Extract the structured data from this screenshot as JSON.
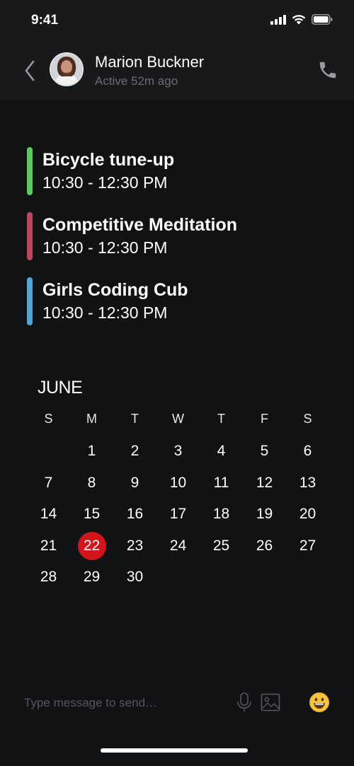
{
  "status_bar": {
    "time": "9:41",
    "icons": [
      "signal-icon",
      "wifi-icon",
      "battery-icon"
    ]
  },
  "header": {
    "back_icon": "chevron-left-icon",
    "contact_name": "Marion Buckner",
    "contact_status": "Active 52m ago",
    "call_icon": "phone-icon"
  },
  "events": [
    {
      "title": "Bicycle tune-up",
      "time": "10:30 - 12:30 PM",
      "color": "#5ccb5f"
    },
    {
      "title": "Competitive Meditation",
      "time": "10:30 - 12:30 PM",
      "color": "#c2455f"
    },
    {
      "title": "Girls Coding Cub",
      "time": "10:30 - 12:30 PM",
      "color": "#4fa8d8"
    }
  ],
  "calendar": {
    "month": "JUNE",
    "weekdays": [
      "S",
      "M",
      "T",
      "W",
      "T",
      "F",
      "S"
    ],
    "leading_blanks": 1,
    "days": [
      "1",
      "2",
      "3",
      "4",
      "5",
      "6",
      "7",
      "8",
      "9",
      "10",
      "11",
      "12",
      "13",
      "14",
      "15",
      "16",
      "17",
      "18",
      "19",
      "20",
      "21",
      "22",
      "23",
      "24",
      "25",
      "26",
      "27",
      "28",
      "29",
      "30"
    ],
    "selected_day": "22",
    "selected_color": "#d2151b"
  },
  "composer": {
    "placeholder": "Type message to send…",
    "value": "",
    "icons": [
      "microphone-icon",
      "image-icon",
      "emoji-icon"
    ]
  }
}
